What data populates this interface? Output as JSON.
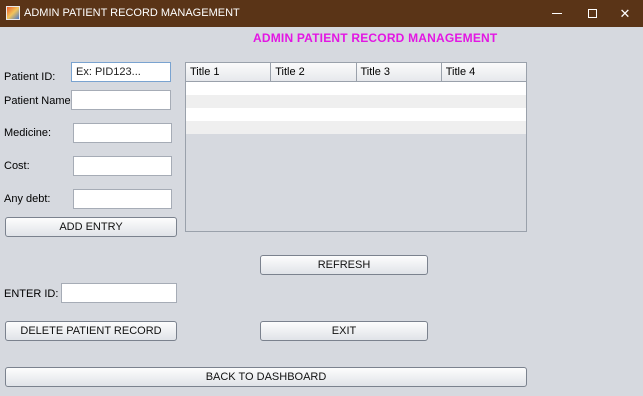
{
  "window": {
    "title": "ADMIN PATIENT RECORD MANAGEMENT",
    "icon": "java-coffee-cup-icon"
  },
  "heading": "ADMIN PATIENT RECORD MANAGEMENT",
  "form": {
    "patient_id_label": "Patient ID:",
    "patient_id_placeholder": "Ex: PID123...",
    "patient_name_label": "Patient Name:",
    "medicine_label": "Medicine:",
    "cost_label": "Cost:",
    "debt_label": "Any debt:",
    "add_entry_label": "ADD ENTRY",
    "enter_id_label": "ENTER ID:",
    "delete_label": "DELETE PATIENT RECORD"
  },
  "table": {
    "columns": [
      "Title 1",
      "Title 2",
      "Title 3",
      "Title 4"
    ],
    "rows": [
      [
        "",
        "",
        "",
        ""
      ],
      [
        "",
        "",
        "",
        ""
      ],
      [
        "",
        "",
        "",
        ""
      ],
      [
        "",
        "",
        "",
        ""
      ]
    ]
  },
  "actions": {
    "refresh_label": "REFRESH",
    "exit_label": "EXIT",
    "back_label": "BACK TO DASHBOARD"
  },
  "colors": {
    "titlebar": "#5a3417",
    "heading": "#e316e3",
    "background": "#d6d9df"
  }
}
